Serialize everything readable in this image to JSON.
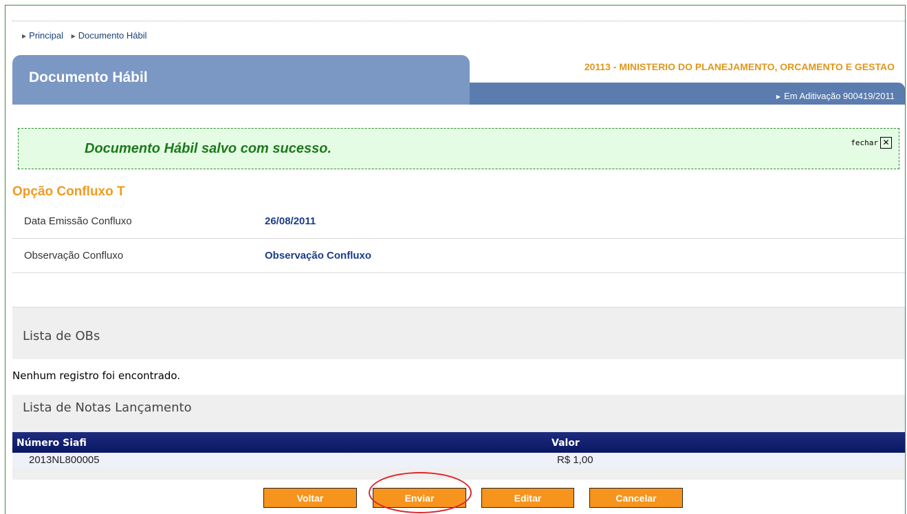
{
  "breadcrumb": {
    "items": [
      "Principal",
      "Documento Hábil"
    ]
  },
  "header": {
    "title": "Documento Hábil",
    "organization": "20113 - MINISTERIO DO PLANEJAMENTO, ORCAMENTO E GESTAO",
    "status": "Em Aditivação 900419/2011"
  },
  "message": {
    "text": "Documento Hábil salvo com sucesso.",
    "close_label": "fechar"
  },
  "section": {
    "title": "Opção Confluxo T",
    "fields": [
      {
        "label": "Data Emissão Confluxo",
        "value": "26/08/2011"
      },
      {
        "label": "Observação Confluxo",
        "value": "Observação Confluxo"
      }
    ]
  },
  "obs_list": {
    "title": "Lista de OBs",
    "empty_text": "Nenhum registro foi encontrado."
  },
  "notes_list": {
    "title": "Lista de Notas Lançamento",
    "columns": [
      "Número Siafi",
      "Valor"
    ],
    "rows": [
      {
        "numero": "2013NL800005",
        "valor": "R$ 1,00"
      }
    ]
  },
  "actions": {
    "voltar": "Voltar",
    "enviar": "Enviar",
    "editar": "Editar",
    "cancelar": "Cancelar"
  },
  "colors": {
    "accent": "#f7941d",
    "header_blue": "#5b7cae",
    "success_green": "#1b7a1b",
    "annotation": "#e0242a"
  }
}
